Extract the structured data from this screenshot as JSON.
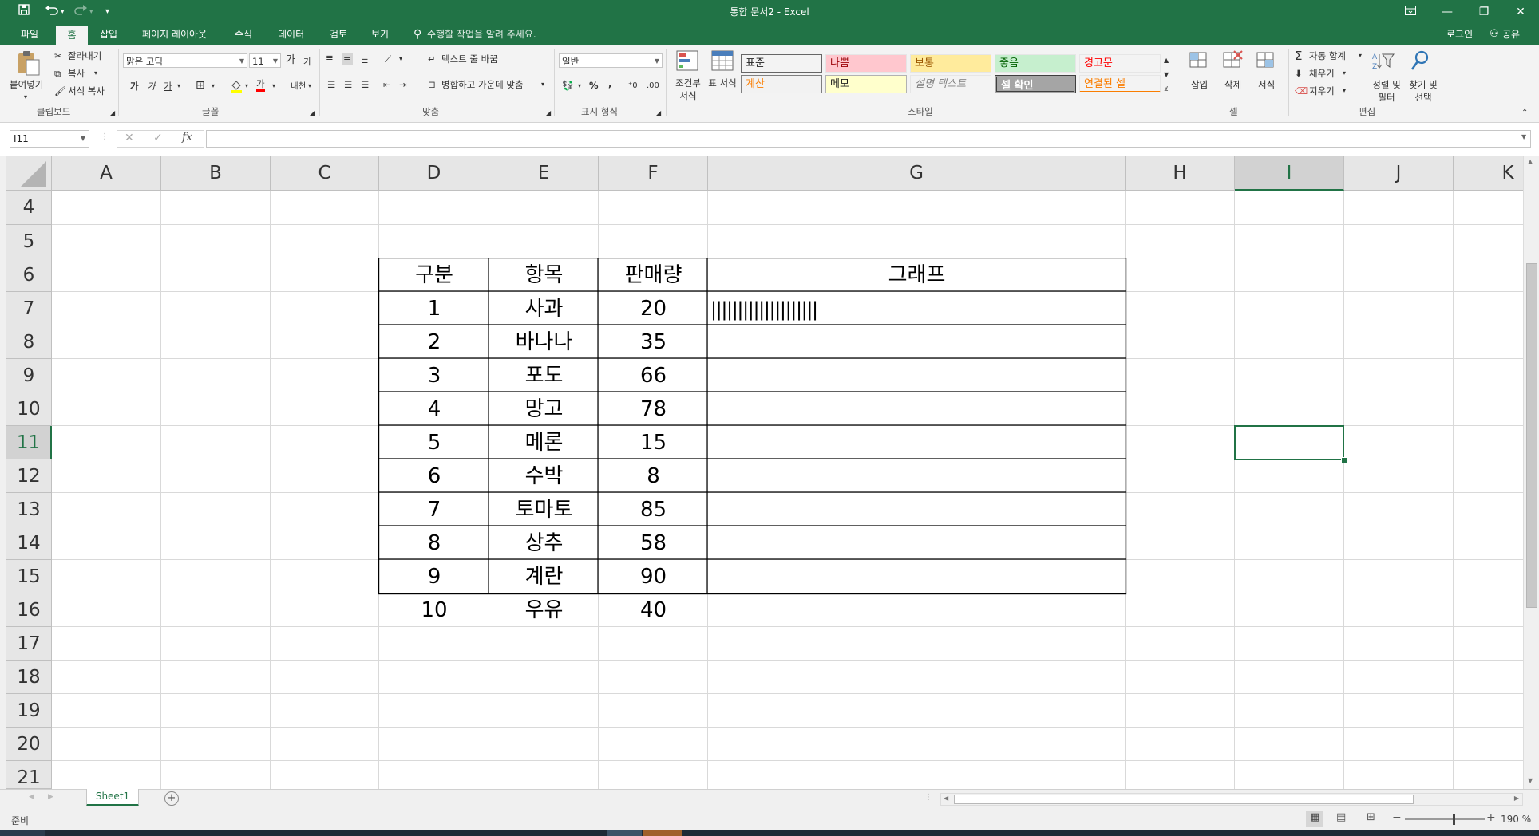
{
  "window": {
    "title": "통합 문서2 - Excel",
    "qat": {
      "save_icon": "save-icon",
      "undo_icon": "undo-icon",
      "redo_icon": "redo-icon",
      "customize_icon": "customize-qat-icon"
    }
  },
  "tabs": [
    "파일",
    "홈",
    "삽입",
    "페이지 레이아웃",
    "수식",
    "데이터",
    "검토",
    "보기"
  ],
  "active_tab": "홈",
  "tell_me": "수행할 작업을 알려 주세요.",
  "account": {
    "login": "로그인",
    "share": "공유"
  },
  "ribbon": {
    "clipboard": {
      "paste": "붙여넣기",
      "cut": "잘라내기",
      "copy": "복사",
      "format_painter": "서식 복사",
      "label": "클립보드"
    },
    "font": {
      "name": "맑은 고딕",
      "size": "11",
      "grow": "가",
      "shrink": "가",
      "bold": "가",
      "italic": "가",
      "underline": "가",
      "font_color": "가",
      "phonetic": "내천",
      "label": "글꼴"
    },
    "alignment": {
      "wrap_text": "텍스트 줄 바꿈",
      "merge_center": "병합하고 가운데 맞춤",
      "label": "맞춤"
    },
    "number": {
      "format": "일반",
      "percent": "%",
      "comma": ",",
      "label": "표시 형식"
    },
    "styles": {
      "conditional_formatting": "조건부 서식",
      "format_as_table": "표 서식",
      "cells": [
        {
          "text": "표준",
          "bg": "#ffffff",
          "color": "#000000"
        },
        {
          "text": "나쁨",
          "bg": "#ffc7ce",
          "color": "#9c0006"
        },
        {
          "text": "보통",
          "bg": "#ffeb9c",
          "color": "#9c5700"
        },
        {
          "text": "좋음",
          "bg": "#c6efce",
          "color": "#006100"
        },
        {
          "text": "경고문",
          "bg": "#ffffff",
          "color": "#ff0000"
        },
        {
          "text": "계산",
          "bg": "#f2f2f2",
          "color": "#fa7d00"
        },
        {
          "text": "메모",
          "bg": "#ffffcc",
          "color": "#000000"
        },
        {
          "text": "설명 텍스트",
          "bg": "#ffffff",
          "color": "#7f7f7f"
        },
        {
          "text": "셀 확인",
          "bg": "#a5a5a5",
          "color": "#ffffff"
        },
        {
          "text": "연결된 셀",
          "bg": "#ffffff",
          "color": "#fa7d00"
        }
      ],
      "label": "스타일"
    },
    "cells": {
      "insert": "삽입",
      "delete": "삭제",
      "format": "서식",
      "label": "셀"
    },
    "editing": {
      "autosum": "자동 합계",
      "fill": "채우기",
      "clear": "지우기",
      "sort_filter": "정렬 및 필터",
      "find_select": "찾기 및 선택",
      "label": "편집"
    }
  },
  "formula_bar": {
    "name_box": "I11",
    "fx": "fx",
    "cancel": "✕",
    "enter": "✓",
    "formula": ""
  },
  "columns": [
    "A",
    "B",
    "C",
    "D",
    "E",
    "F",
    "G",
    "H",
    "I",
    "J",
    "K"
  ],
  "rows": [
    "4",
    "5",
    "6",
    "7",
    "8",
    "9",
    "10",
    "11",
    "12",
    "13",
    "14",
    "15",
    "16",
    "17",
    "18",
    "19",
    "20",
    "21"
  ],
  "selected_cell": "I11",
  "table": {
    "headers": [
      "구분",
      "항목",
      "판매량",
      "그래프"
    ],
    "rows": [
      [
        "1",
        "사과",
        "20",
        "||||||||||||||||||||"
      ],
      [
        "2",
        "바나나",
        "35",
        ""
      ],
      [
        "3",
        "포도",
        "66",
        ""
      ],
      [
        "4",
        "망고",
        "78",
        ""
      ],
      [
        "5",
        "메론",
        "15",
        ""
      ],
      [
        "6",
        "수박",
        "8",
        ""
      ],
      [
        "7",
        "토마토",
        "85",
        ""
      ],
      [
        "8",
        "상추",
        "58",
        ""
      ],
      [
        "9",
        "계란",
        "90",
        ""
      ],
      [
        "10",
        "우유",
        "40",
        ""
      ]
    ]
  },
  "sheet_tabs": [
    "Sheet1"
  ],
  "status": {
    "ready": "준비",
    "zoom": "190 %"
  },
  "colors": {
    "excel_green": "#217346",
    "ribbon_bg": "#f3f3f3",
    "header_bg": "#e6e6e6"
  }
}
